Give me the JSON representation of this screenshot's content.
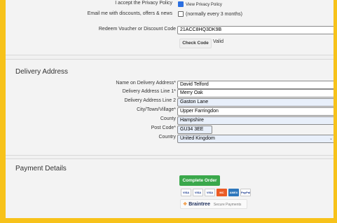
{
  "consent": {
    "privacy_label": "I accept the Privacy Policy",
    "privacy_option": "View Privacy Policy",
    "email_label": "Email me with discounts, offers & news",
    "email_option": "(normally every 3 months)"
  },
  "voucher": {
    "label": "Redeem Voucher or Discount Code",
    "value": "21ACC8HQ3DK9B",
    "check_button": "Check Code",
    "status": "Valid"
  },
  "delivery": {
    "title": "Delivery Address",
    "fields": [
      {
        "label": "Name on Delivery Address*",
        "value": "David Telford"
      },
      {
        "label": "Delivery Address Line 1*",
        "value": "Merry Oak"
      },
      {
        "label": "Delivery Address Line 2",
        "value": "Gaston Lane"
      },
      {
        "label": "City/Town/Village*",
        "value": "Upper Farringdon"
      },
      {
        "label": "County",
        "value": "Hampshire"
      },
      {
        "label": "Post Code*",
        "value": "GU34 3EE"
      },
      {
        "label": "Country",
        "value": "United Kingdom"
      }
    ]
  },
  "payment": {
    "title": "Payment Details",
    "order_button": "Complete Order",
    "cards": [
      "VISA",
      "VISA",
      "VISA",
      "MC",
      "AMEX",
      "PayPal"
    ],
    "braintree_name": "Braintree",
    "braintree_sub": "Secure Payments"
  },
  "colors": {
    "border_accent": "#f7c21a",
    "order_button": "#3aa84b",
    "autofill_field": "#e8effa"
  }
}
